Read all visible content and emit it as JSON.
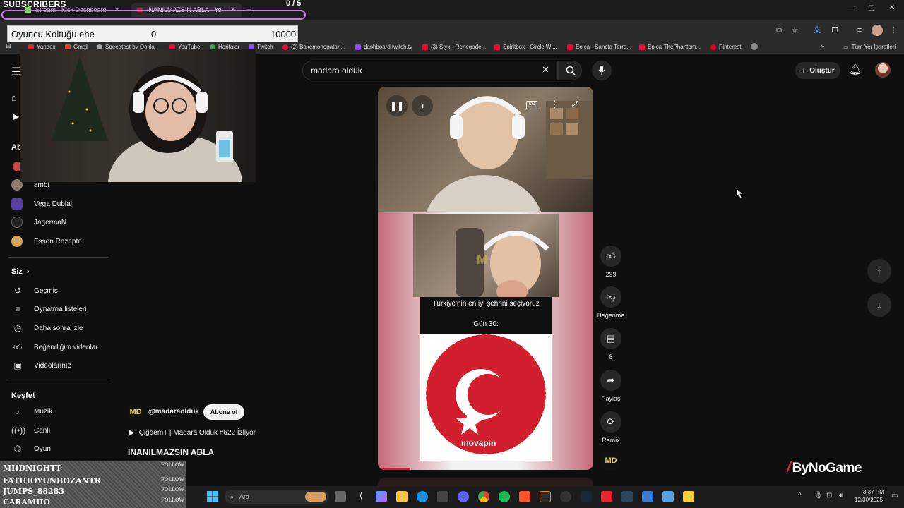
{
  "overlay": {
    "subs_title": "SUBSCRIBERS",
    "subs_count": "0 / 5",
    "goal_name": "Oyuncu Koltuğu ehe",
    "goal_current": "0",
    "goal_target": "10000"
  },
  "browser": {
    "tabs": [
      {
        "label": "Stream - Kick Dashboard"
      },
      {
        "label": "INANILMAZSIN ABLA - Yo"
      }
    ],
    "bookmarks": [
      "Yandex",
      "Gmail",
      "Speedtest by Ookla",
      "YouTube",
      "Haritalar",
      "Twitch",
      "(2) Bakemonogatari...",
      "dashboard.twitch.tv",
      "(3) Styx - Renegade...",
      "Spiritbox - Circle Wi...",
      "Epica - Sancta Terra...",
      "Epica-ThePhantom...",
      "Pinterest"
    ],
    "all_bookmarks": "Tüm Yer İşaretleri"
  },
  "youtube": {
    "search_value": "madara olduk",
    "create_label": "Oluştur",
    "sidebar": {
      "subs_head": "Ab",
      "subscriptions": [
        "ambi",
        "Vega Dublaj",
        "JagermaN",
        "Essen Rezepte"
      ],
      "you_head": "Siz",
      "you_items": [
        "Geçmiş",
        "Oynatma listeleri",
        "Daha sonra izle",
        "Beğendiğim videolar",
        "Videolarınız"
      ],
      "explore_head": "Keşfet",
      "explore_items": [
        "Müzik",
        "Canlı",
        "Oyun"
      ]
    },
    "short": {
      "channel": "@madaraolduk",
      "subscribe": "Abone ol",
      "live_line": "ÇiğdemT | Madara Olduk #622 İzliyor",
      "title": "INANILMAZSIN ABLA",
      "caption_line1": "Türkiye'nin en iyi şehrini seçiyoruz",
      "caption_line2": "Gün 30:",
      "sponsor": "inovapin",
      "watermark": "M",
      "likes": "299",
      "dislike_label": "Beğenme",
      "comments": "8",
      "share_label": "Paylaş",
      "remix_label": "Remix",
      "channel_logo": "MD"
    }
  },
  "bynogame": "ByNoGame",
  "chat": [
    {
      "name": "MIIDNIGHTT",
      "action": "FOLLOW"
    },
    {
      "name": "FATIHOYUNBOZANTR",
      "action": "FOLLOW"
    },
    {
      "name": "JUMPS_88283",
      "action": "FOLLOW"
    },
    {
      "name": "CARAMIIO",
      "action": "FOLLOW"
    }
  ],
  "taskbar": {
    "search_placeholder": "Ara",
    "time": "8:37 PM",
    "date": "12/30/2025"
  },
  "colors": {
    "overlay_bar": "#c77be0",
    "subscribe_bg": "#f1f1f1",
    "bynogame_red": "#e8252b"
  }
}
